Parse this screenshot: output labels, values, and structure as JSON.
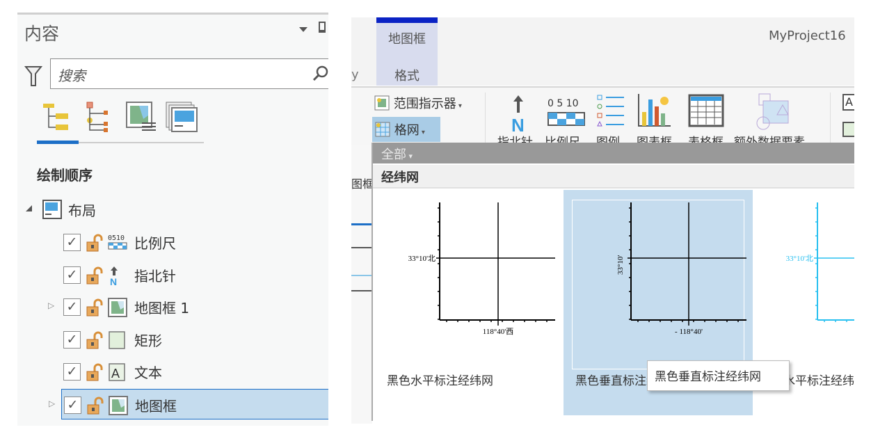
{
  "contents_pane": {
    "title": "内容",
    "search_placeholder": "搜索",
    "section_title": "绘制顺序",
    "root": {
      "label": "布局",
      "expanded": true
    },
    "items": [
      {
        "label": "比例尺",
        "icon": "scale-bar-icon",
        "checked": true,
        "expandable": false
      },
      {
        "label": "指北针",
        "icon": "north-arrow-icon",
        "checked": true,
        "expandable": false
      },
      {
        "label": "地图框 1",
        "icon": "map-frame-icon",
        "checked": true,
        "expandable": true
      },
      {
        "label": "矩形",
        "icon": "rectangle-icon",
        "checked": true,
        "expandable": false
      },
      {
        "label": "文本",
        "icon": "text-icon",
        "checked": true,
        "expandable": false
      },
      {
        "label": "地图框",
        "icon": "map-frame-icon",
        "checked": true,
        "expandable": true,
        "selected": true
      }
    ]
  },
  "ribbon": {
    "context_tab_group": "地图框",
    "context_tab": "格式",
    "project_title": "MyProject16",
    "extent_indicator": "范围指示器",
    "grid": "格网",
    "tools": [
      "指北针",
      "比例尺",
      "图例",
      "图表框",
      "表格框",
      "额外数据要素"
    ],
    "side_fragment": "图框",
    "scale_numbers": "0 5 10"
  },
  "gallery": {
    "filter": "全部",
    "category": "经纬网",
    "items": [
      {
        "label": "黑色水平标注经纬网",
        "lat_label": "33°10'北",
        "lon_label": "118°40'西",
        "color": "#000000"
      },
      {
        "label": "黑色垂直标注经纬网",
        "lat_label": "33°10'",
        "lon_label": "- 118°40'",
        "color": "#000000",
        "selected": true
      },
      {
        "label": "黑色水平标注经纬网",
        "lat_label": "33°10'北",
        "color": "#29c0f0"
      }
    ],
    "tooltip": "黑色垂直标注经纬网"
  },
  "colors": {
    "accent": "#1d6fc7",
    "selection": "#c5dcee",
    "context_tab": "#d8dcee",
    "context_bar": "#0a22c4"
  }
}
